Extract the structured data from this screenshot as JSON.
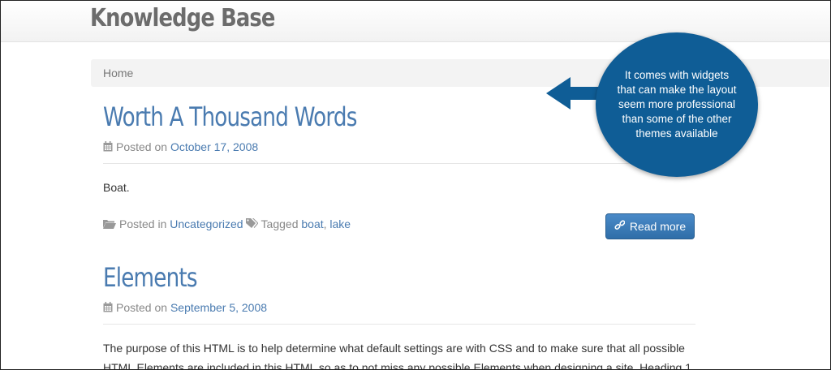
{
  "header": {
    "site_title": "Knowledge Base"
  },
  "breadcrumb": {
    "home": "Home"
  },
  "posts": [
    {
      "title": "Worth A Thousand Words",
      "posted_on_label": "Posted on",
      "date": "October 17, 2008",
      "excerpt": "Boat.",
      "posted_in_label": "Posted in",
      "category": "Uncategorized",
      "tagged_label": "Tagged",
      "tags": [
        "boat",
        "lake"
      ],
      "tag_separator": ",",
      "read_more": "Read more"
    },
    {
      "title": "Elements",
      "posted_on_label": "Posted on",
      "date": "September 5, 2008",
      "excerpt_line1": "The purpose of this HTML is to help determine what default settings are with CSS and to make sure that all possible",
      "excerpt_line2": "HTML Elements are included in this HTML so as to not miss any possible Elements when designing a site. Heading 1"
    }
  ],
  "callout": {
    "text": "It comes with widgets that can make the layout seem more professional than some of the other themes available"
  },
  "colors": {
    "link": "#4a7bb0",
    "callout_bg": "#0f5d96",
    "button_bg": "#337ab7"
  },
  "icons": [
    "calendar-icon",
    "folder-icon",
    "tags-icon",
    "link-icon",
    "arrow-left-icon"
  ]
}
